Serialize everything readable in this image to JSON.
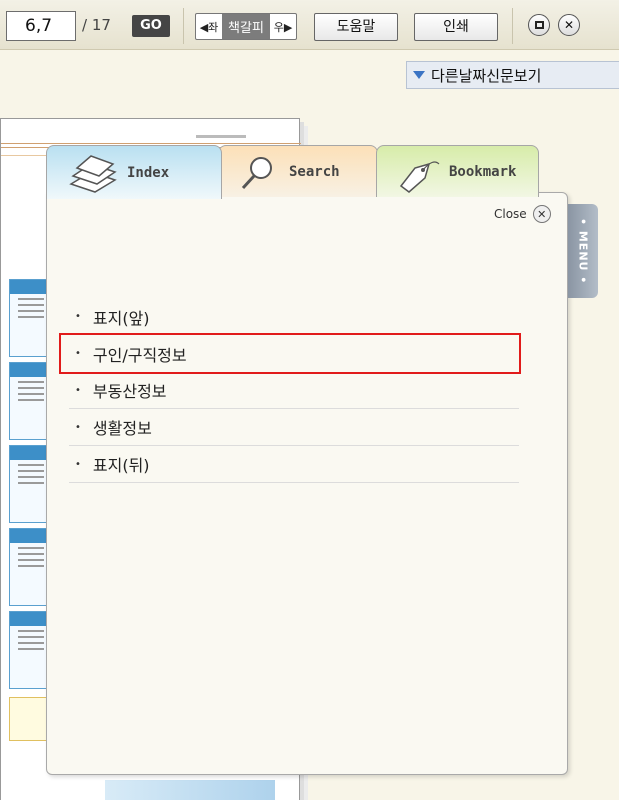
{
  "toolbar": {
    "page_value": "6,7",
    "page_total": "/ 17",
    "go_label": "GO",
    "bookmark_nav": {
      "left": "◀좌",
      "middle": "책갈피",
      "right": "우▶"
    },
    "help_label": "도움말",
    "print_label": "인쇄",
    "restore_icon": "square-icon",
    "close_icon": "x-circle-icon"
  },
  "other_days_label": "다른날짜신문보기",
  "tabs": [
    {
      "label": "Index",
      "icon": "paper-stack-icon",
      "color": "#b9e0f1"
    },
    {
      "label": "Search",
      "icon": "magnifier-icon",
      "color": "#fce0b8"
    },
    {
      "label": "Bookmark",
      "icon": "tag-icon",
      "color": "#d7eca9"
    }
  ],
  "panel": {
    "close_label": "Close",
    "menu_label": "• MENU •",
    "selected_color": "#e11b1b",
    "items": [
      {
        "label": "표지(앞)"
      },
      {
        "label": "구인/구직정보",
        "selected": true
      },
      {
        "label": "부동산정보"
      },
      {
        "label": "생활정보"
      },
      {
        "label": "표지(뒤)"
      }
    ]
  }
}
